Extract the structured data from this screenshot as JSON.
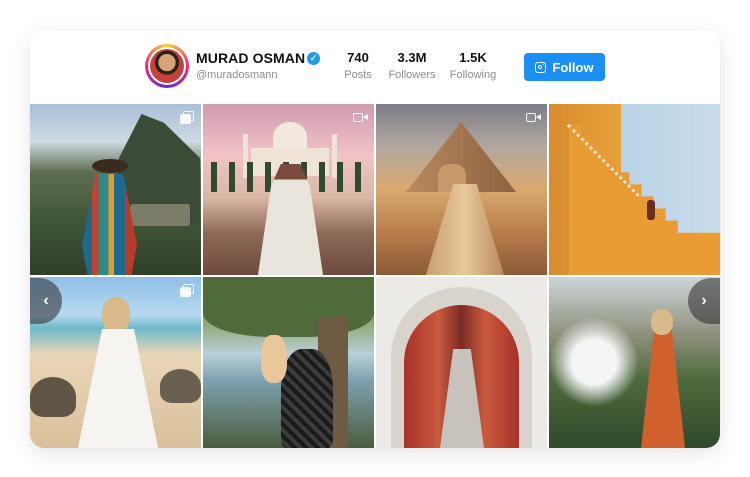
{
  "profile": {
    "name": "MURAD OSMAN",
    "handle": "@muradosmann",
    "verified_icon": "verified-check-icon",
    "stats": [
      {
        "value": "740",
        "label": "Posts"
      },
      {
        "value": "3.3M",
        "label": "Followers"
      },
      {
        "value": "1.5K",
        "label": "Following"
      }
    ],
    "follow_label": "Follow"
  },
  "colors": {
    "accent": "#1c8ff5",
    "verified": "#1d9bf0",
    "muted_text": "#8e8e8e"
  },
  "navigation": {
    "prev_icon": "chevron-left-icon",
    "next_icon": "chevron-right-icon",
    "prev_glyph": "‹",
    "next_glyph": "›"
  },
  "posts": [
    {
      "subject": "machu-picchu",
      "badge": "multiple-images-icon"
    },
    {
      "subject": "taj-mahal",
      "badge": "video-icon"
    },
    {
      "subject": "pyramid-giza",
      "badge": "video-icon"
    },
    {
      "subject": "ochre-wall-staircase",
      "badge": ""
    },
    {
      "subject": "beach-tortoises",
      "badge": "multiple-images-icon"
    },
    {
      "subject": "tree-with-child",
      "badge": ""
    },
    {
      "subject": "moroccan-archway",
      "badge": ""
    },
    {
      "subject": "waterfall-canyon",
      "badge": ""
    }
  ]
}
